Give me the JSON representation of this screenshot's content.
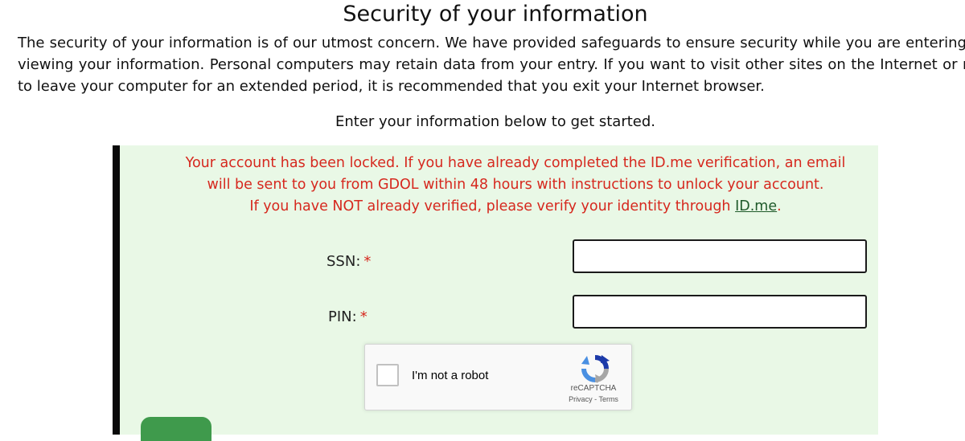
{
  "page": {
    "title": "Security of your information",
    "intro": "The security of your information is of our utmost concern. We have provided safeguards to ensure security while you are entering and viewing your information. Personal computers may retain data from your entry. If you want to visit other sites on the Internet or need to leave your computer for an extended period, it is recommended that you exit your Internet browser.",
    "lead": "Enter your information below to get started."
  },
  "alert": {
    "line1": "Your account has been locked. If you have already completed the ID.me verification, an email",
    "line2": "will be sent to you from GDOL within 48 hours with instructions to unlock your account.",
    "line3_prefix": "If you have NOT already verified, please verify your identity through ",
    "link": "ID.me",
    "line3_suffix": "."
  },
  "form": {
    "ssn_label": "SSN:",
    "pin_label": "PIN:",
    "required_mark": "*",
    "ssn_value": "",
    "pin_value": ""
  },
  "recaptcha": {
    "label": "I'm not a robot",
    "brand": "reCAPTCHA",
    "privacy": "Privacy",
    "separator": "-",
    "terms": "Terms",
    "icon": "recaptcha-logo-icon"
  },
  "colors": {
    "alert_text": "#d6281e",
    "panel_bg": "#e9f8e6",
    "panel_border": "#0a0a0a",
    "link": "#1f5a2a",
    "button": "#3f9a4c"
  }
}
